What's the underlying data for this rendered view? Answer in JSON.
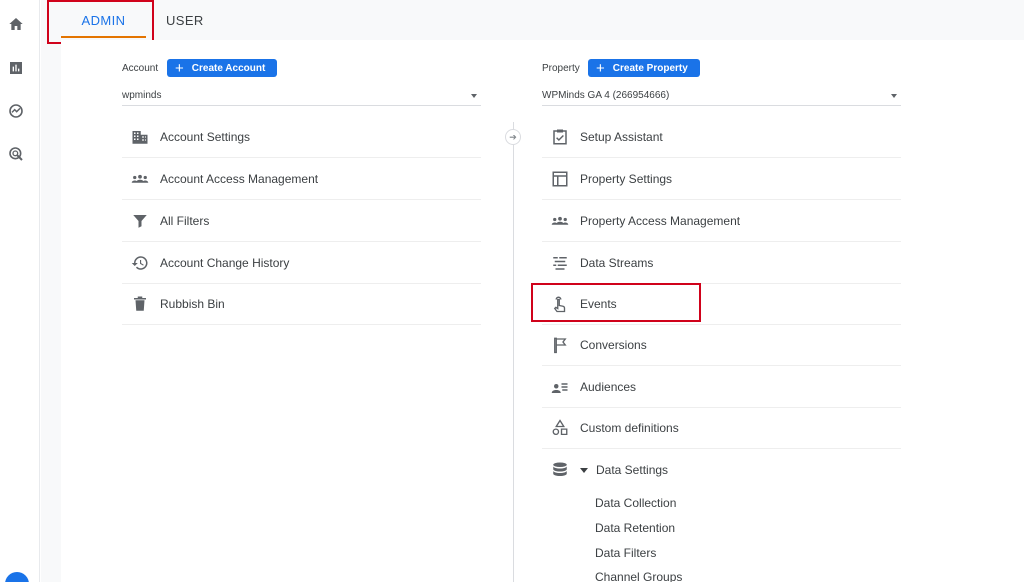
{
  "tabs": {
    "admin": "ADMIN",
    "user": "USER"
  },
  "rail": {
    "icons": [
      "home-icon",
      "reports-icon",
      "explore-icon",
      "advertising-icon"
    ]
  },
  "account": {
    "label": "Account",
    "create_label": "Create Account",
    "selected": "wpminds",
    "items": [
      {
        "label": "Account Settings",
        "icon": "building-icon"
      },
      {
        "label": "Account Access Management",
        "icon": "people-icon"
      },
      {
        "label": "All Filters",
        "icon": "filter-icon"
      },
      {
        "label": "Account Change History",
        "icon": "history-icon"
      },
      {
        "label": "Rubbish Bin",
        "icon": "trash-icon"
      }
    ]
  },
  "property": {
    "label": "Property",
    "create_label": "Create Property",
    "selected": "WPMinds GA 4 (266954666)",
    "items": [
      {
        "label": "Setup Assistant",
        "icon": "checklist-icon"
      },
      {
        "label": "Property Settings",
        "icon": "layout-icon"
      },
      {
        "label": "Property Access Management",
        "icon": "people-icon"
      },
      {
        "label": "Data Streams",
        "icon": "streams-icon"
      },
      {
        "label": "Events",
        "icon": "touch-icon"
      },
      {
        "label": "Conversions",
        "icon": "flag-icon"
      },
      {
        "label": "Audiences",
        "icon": "audience-icon"
      },
      {
        "label": "Custom definitions",
        "icon": "shapes-icon"
      },
      {
        "label": "Data Settings",
        "icon": "database-icon"
      }
    ],
    "data_settings_sub": [
      "Data Collection",
      "Data Retention",
      "Data Filters",
      "Channel Groups"
    ]
  },
  "colors": {
    "accent": "#1a73e8",
    "highlight": "#d0021b",
    "tab_underline": "#e37400"
  }
}
